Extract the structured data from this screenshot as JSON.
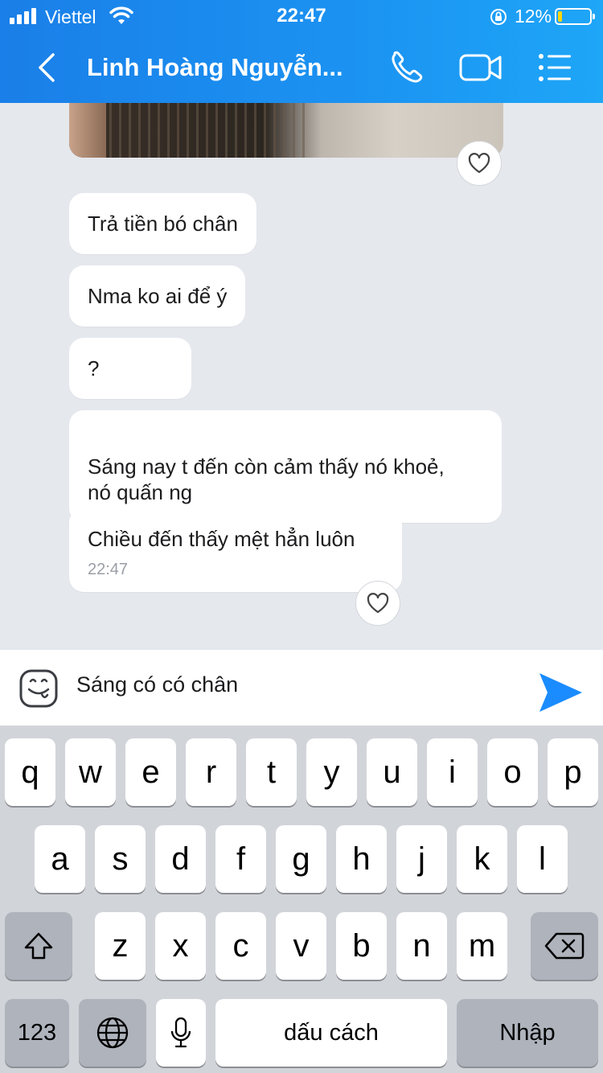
{
  "status_bar": {
    "carrier": "Viettel",
    "time": "22:47",
    "battery_percent": "12%",
    "battery_level": 0.12,
    "icons": [
      "signal-icon",
      "wifi-icon",
      "orientation-lock-icon",
      "battery-icon"
    ]
  },
  "header": {
    "contact_name": "Linh Hoàng Nguyễn...",
    "icons": [
      "back-chevron-icon",
      "phone-icon",
      "video-call-icon",
      "menu-list-icon"
    ]
  },
  "messages": [
    {
      "text": "Trả tiền bó chân"
    },
    {
      "text": "Nma ko ai để ý"
    },
    {
      "text": "?"
    },
    {
      "text": "Sáng nay t đến còn cảm thấy nó khoẻ,\nnó quấn ng"
    },
    {
      "text": "Chiều đến thấy mệt hẳn luôn",
      "time": "22:47"
    }
  ],
  "composer": {
    "value": "Sáng có có chân",
    "icons": [
      "sticker-icon",
      "send-icon"
    ]
  },
  "keyboard": {
    "row1": [
      "q",
      "w",
      "e",
      "r",
      "t",
      "y",
      "u",
      "i",
      "o",
      "p"
    ],
    "row2": [
      "a",
      "s",
      "d",
      "f",
      "g",
      "h",
      "j",
      "k",
      "l"
    ],
    "row3": [
      "z",
      "x",
      "c",
      "v",
      "b",
      "n",
      "m"
    ],
    "numbers_key": "123",
    "space_key": "dấu cách",
    "return_key": "Nhập",
    "icons": [
      "shift-icon",
      "backspace-icon",
      "globe-icon",
      "microphone-icon"
    ]
  },
  "colors": {
    "header_gradient_start": "#1a7fe8",
    "header_gradient_end": "#1ea6f7",
    "chat_background": "#e5e8ed",
    "send_blue": "#1a8cff",
    "keyboard_background": "#d1d4d9"
  }
}
